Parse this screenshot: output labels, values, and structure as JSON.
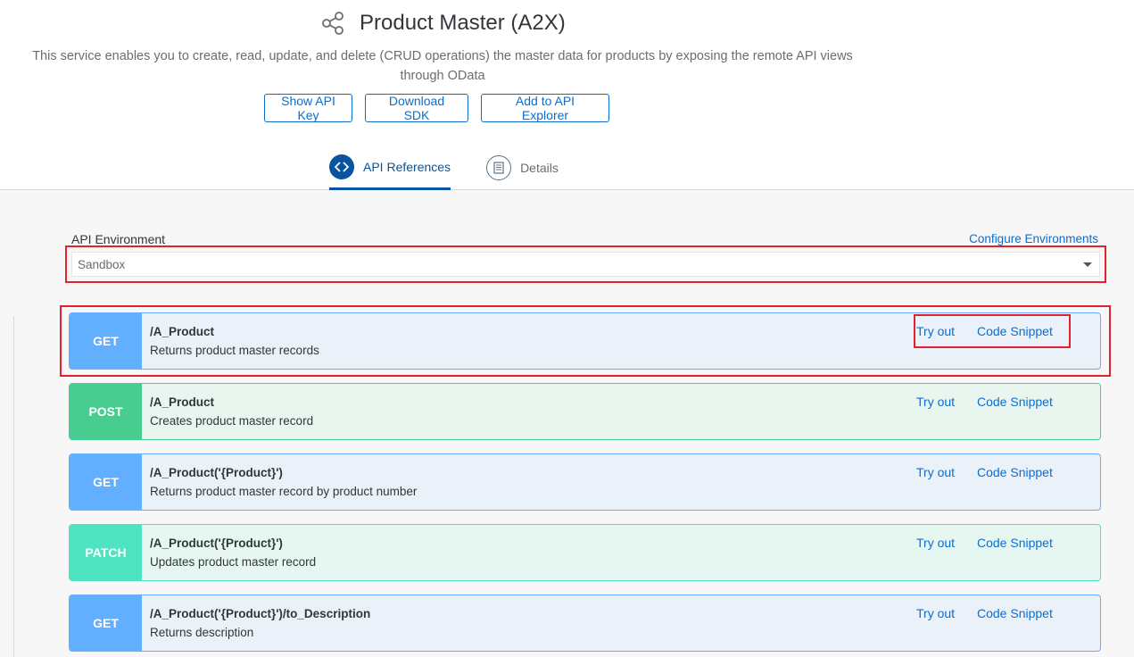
{
  "header": {
    "title": "Product Master (A2X)",
    "description": "This service enables you to create, read, update, and delete (CRUD operations) the master data for products by exposing the remote API views through OData",
    "buttons": {
      "show_api_key": "Show API Key",
      "download_sdk": "Download SDK",
      "add_to_api_explorer": "Add to API Explorer"
    },
    "tabs": {
      "api_references": "API References",
      "details": "Details"
    }
  },
  "environment": {
    "label": "API Environment",
    "configure_link": "Configure Environments",
    "selected": "Sandbox"
  },
  "endpoints": [
    {
      "method": "GET",
      "path": "/A_Product",
      "description": "Returns product master records",
      "try_out": "Try out",
      "code_snippet": "Code Snippet"
    },
    {
      "method": "POST",
      "path": "/A_Product",
      "description": "Creates product master record",
      "try_out": "Try out",
      "code_snippet": "Code Snippet"
    },
    {
      "method": "GET",
      "path": "/A_Product('{Product}')",
      "description": "Returns product master record by product number",
      "try_out": "Try out",
      "code_snippet": "Code Snippet"
    },
    {
      "method": "PATCH",
      "path": "/A_Product('{Product}')",
      "description": "Updates product master record",
      "try_out": "Try out",
      "code_snippet": "Code Snippet"
    },
    {
      "method": "GET",
      "path": "/A_Product('{Product}')/to_Description",
      "description": "Returns description",
      "try_out": "Try out",
      "code_snippet": "Code Snippet"
    }
  ],
  "colors": {
    "link": "#0a6ed1",
    "get": "#61affe",
    "post": "#49cc90",
    "patch": "#50e3c2",
    "highlight": "#e3202c"
  },
  "icons": {
    "title": "share-icon",
    "tab_active": "code-icon",
    "tab_inactive": "document-icon",
    "select": "caret-down-icon"
  }
}
